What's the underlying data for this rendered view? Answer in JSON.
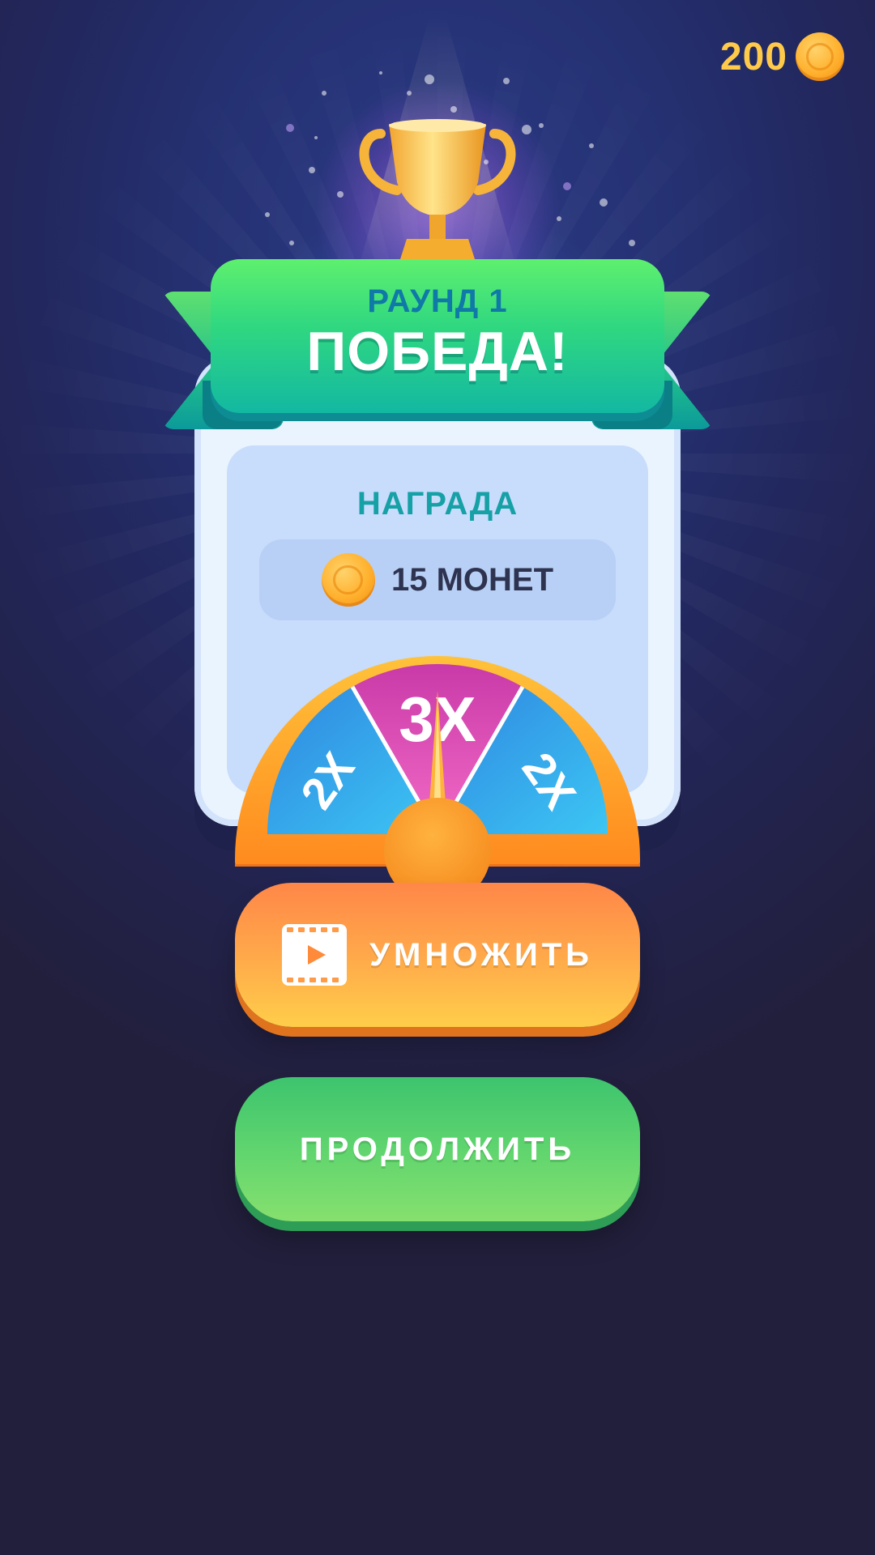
{
  "header": {
    "coin_count": "200",
    "coin_icon": "coin-icon"
  },
  "banner": {
    "round_label": "РАУНД 1",
    "title": "ПОБЕДА!"
  },
  "reward": {
    "label": "НАГРАДА",
    "amount_text": "15 МОНЕТ",
    "icon": "coin-icon"
  },
  "multiplier_wheel": {
    "segments": [
      "2X",
      "3X",
      "2X"
    ],
    "selected_segment": "3X",
    "colors": {
      "side": "#35a6ec",
      "center": "#e54fb8",
      "rim": "#ffa62e"
    }
  },
  "buttons": {
    "multiply_label": "УМНОЖИТЬ",
    "multiply_icon": "video-play-icon",
    "continue_label": "ПРОДОЛЖИТЬ"
  },
  "colors": {
    "accent_orange": "#ffa84a",
    "accent_green": "#63d66e",
    "title_teal": "#15a1a6",
    "coin_gold": "#ffc94a"
  }
}
